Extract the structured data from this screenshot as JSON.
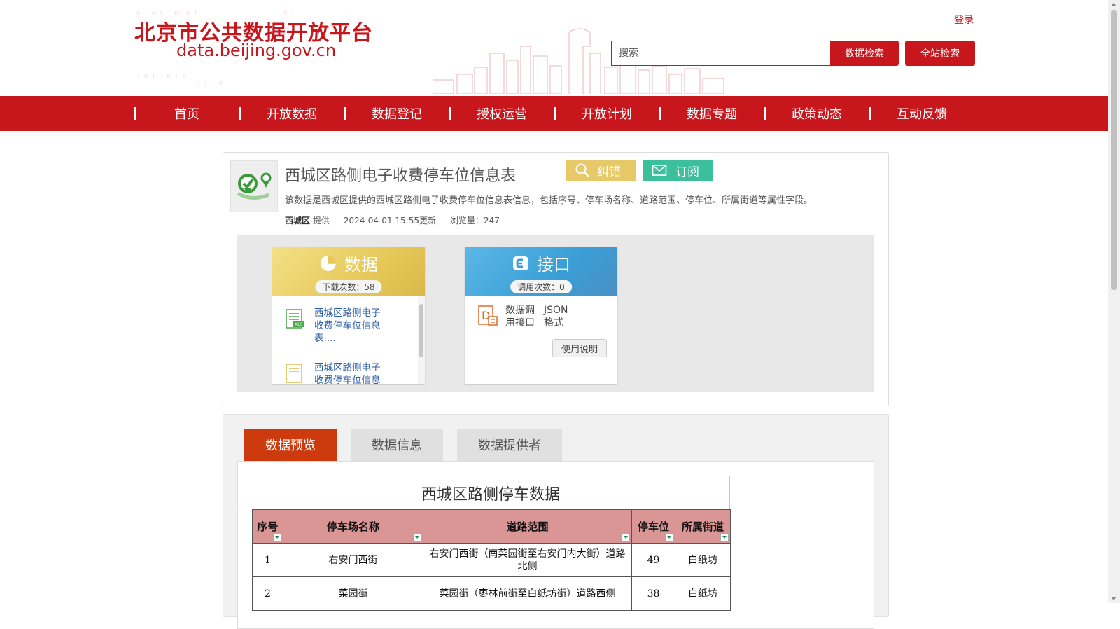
{
  "header": {
    "logo_cn": "北京市公共数据开放平台",
    "logo_en": "data.beijing.gov.cn",
    "login": "登录",
    "search_placeholder": "搜索",
    "btn_data_search": "数据检索",
    "btn_all_search": "全站检索"
  },
  "nav": {
    "items": [
      "首页",
      "开放数据",
      "数据登记",
      "授权运营",
      "开放计划",
      "数据专题",
      "政策动态",
      "互动反馈"
    ]
  },
  "dataset": {
    "title": "西城区路侧电子收费停车位信息表",
    "btn_correct": "纠错",
    "btn_subscribe": "订阅",
    "description": "该数据是西城区提供的西城区路侧电子收费停车位信息表信息，包括序号、停车场名称、道路范围、停车位、所属街道等属性字段。",
    "provider": "西城区",
    "provider_suffix": "提供",
    "updated": "2024-04-01 15:55更新",
    "views": "浏览量：247"
  },
  "data_box": {
    "title": "数据",
    "downloads": "下载次数：58",
    "files": [
      {
        "name": "西城区路侧电子收费停车位信息表....",
        "icon": "xls-file-icon"
      },
      {
        "name": "西城区路侧电子收费停车位信息",
        "icon": "file-icon"
      }
    ]
  },
  "api_box": {
    "title": "接口",
    "calls": "调用次数：0",
    "desc": "数据调用接口",
    "format": "JSON格式",
    "usage_btn": "使用说明"
  },
  "tabs": [
    "数据预览",
    "数据信息",
    "数据提供者"
  ],
  "preview": {
    "sheet_title": "西城区路侧停车数据",
    "headers": [
      "序号",
      "停车场名称",
      "道路范围",
      "停车位",
      "所属街道"
    ],
    "rows": [
      [
        "1",
        "右安门西街",
        "右安门西街（南菜园街至右安门内大街）道路北侧",
        "49",
        "白纸坊"
      ],
      [
        "2",
        "菜园街",
        "菜园街（枣林前街至白纸坊街）道路西侧",
        "38",
        "白纸坊"
      ]
    ]
  },
  "colors": {
    "brand_red": "#c8161d",
    "tab_active": "#cc3a0e",
    "correct_yellow": "#e8c96a",
    "subscribe_green": "#3cbf9d",
    "header_cell": "#da9694"
  }
}
